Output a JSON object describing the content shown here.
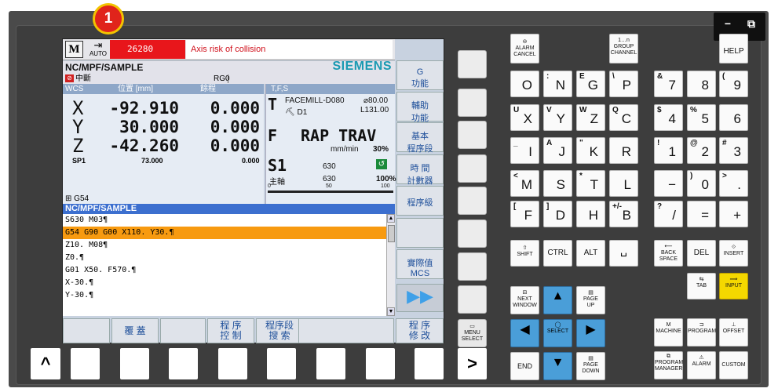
{
  "marker": "1",
  "window": {
    "minimize": "−",
    "restore": "⧉"
  },
  "header": {
    "m": "M",
    "auto": "AUTO",
    "alarm_number": "26280",
    "alarm_text": "Axis  risk of collision"
  },
  "path": "NC/MPF/SAMPLE",
  "brand": "SIEMENS",
  "state": {
    "status": "中斷",
    "rg": "RG0"
  },
  "wcs": {
    "head": [
      "WCS",
      "位置 [mm]",
      "餘程"
    ],
    "axes": [
      {
        "name": "X",
        "pos": "-92.910",
        "dist": "0.000"
      },
      {
        "name": "Y",
        "pos": "30.000",
        "dist": "0.000"
      },
      {
        "name": "Z",
        "pos": "-42.260",
        "dist": "0.000"
      }
    ],
    "sp1": {
      "name": "SP1",
      "pos": "73.000",
      "dist": "0.000"
    },
    "frame": "G54"
  },
  "tfs": {
    "head": "T,F,S",
    "tool": "FACEMILL-D080",
    "dia": "⌀80.00",
    "len": "L131.00",
    "d": "D1",
    "feed": "RAP TRAV",
    "feed_unit": "mm/min",
    "feed_pct": "30%",
    "spindle": "S1",
    "spindle_lbl": "主軸",
    "s_set": "630",
    "s_act": "630",
    "s_pct": "100%",
    "s_50": "50",
    "s_100": "100",
    "s_0": "0"
  },
  "program": {
    "name": "NC/MPF/SAMPLE",
    "lines": [
      "S630 M03¶",
      "G54 G90 G00 X110. Y30.¶",
      "Z10.  M08¶",
      "Z0.¶",
      "G01 X50.  F570.¶",
      "X-30.¶",
      "Y-30.¶"
    ],
    "active": 1
  },
  "softkeys_right": [
    "G\n功能",
    "輔助\n功能",
    "基本\n程序段",
    "時 間\n計數器",
    "程序級",
    "",
    "實際值\nMCS",
    "▶▶"
  ],
  "softkeys_bottom": [
    "",
    "覆 蓋",
    "",
    "程 序\n控 制",
    "程序段\n搜 索",
    "",
    "程 序\n修 改"
  ],
  "panel": {
    "alarm_cancel": "ALARM\nCANCEL",
    "group_channel": "GROUP\nCHANNEL",
    "help": "HELP",
    "letters": [
      [
        "O",
        "N",
        "G",
        "P"
      ],
      [
        "X",
        "Y",
        "Z",
        "C"
      ],
      [
        "I",
        "J",
        "K",
        "R"
      ],
      [
        "M",
        "S",
        "T",
        "L"
      ],
      [
        "F",
        "D",
        "H",
        "B"
      ]
    ],
    "letters_small": [
      [
        "",
        ":",
        "E",
        "\\"
      ],
      [
        "U",
        "V",
        "W",
        "Q"
      ],
      [
        "_",
        "A",
        "\"",
        ""
      ],
      [
        "<",
        "",
        "*",
        ""
      ],
      [
        "[",
        "]",
        "",
        "+/-"
      ]
    ],
    "nums": [
      [
        "7",
        "8",
        "9"
      ],
      [
        "4",
        "5",
        "6"
      ],
      [
        "1",
        "2",
        "3"
      ],
      [
        "−",
        "0",
        "."
      ],
      [
        "/",
        "=",
        "+"
      ]
    ],
    "nums_small": [
      [
        "&",
        "",
        "("
      ],
      [
        "$",
        "%",
        ""
      ],
      [
        "!",
        "@",
        "#"
      ],
      [
        "",
        ")",
        ">"
      ],
      [
        "?",
        "",
        ""
      ]
    ],
    "shift": "SHIFT",
    "ctrl": "CTRL",
    "alt": "ALT",
    "space": "␣",
    "backspace": "BACK\nSPACE",
    "del": "DEL",
    "insert": "INSERT",
    "tab": "TAB",
    "input": "INPUT",
    "next_window": "NEXT\nWINDOW",
    "page_up": "PAGE\nUP",
    "select": "SELECT",
    "end": "END",
    "page_down": "PAGE\nDOWN",
    "menu_select": "MENU\nSELECT",
    "machine": "MACHINE",
    "program": "PROGRAM",
    "offset": "OFFSET",
    "program_manager": "PROGRAM\nMANAGER",
    "alarm": "ALARM",
    "custom": "CUSTOM",
    "caret": "^",
    "next": ">"
  }
}
